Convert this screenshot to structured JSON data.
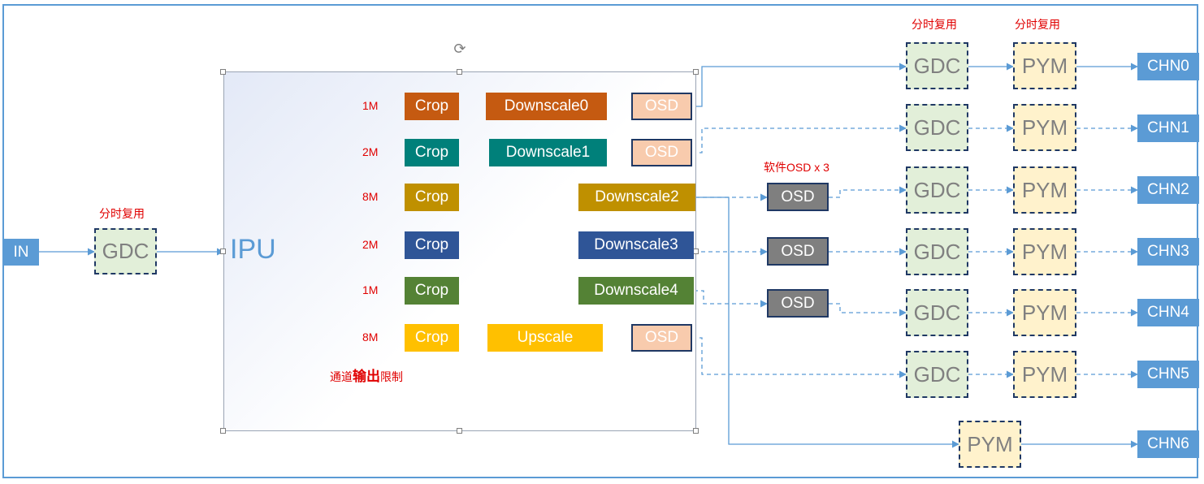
{
  "input": "IN",
  "input_gdc": {
    "label": "GDC",
    "note": "分时复用"
  },
  "ipu": {
    "title": "IPU",
    "limit_note": {
      "prefix": "通道",
      "bold": "输出",
      "suffix": "限制"
    },
    "channels": [
      {
        "size": "1M",
        "crop": "Crop",
        "scale": "Downscale0",
        "osd": "OSD"
      },
      {
        "size": "2M",
        "crop": "Crop",
        "scale": "Downscale1",
        "osd": "OSD"
      },
      {
        "size": "8M",
        "crop": "Crop",
        "scale": "Downscale2"
      },
      {
        "size": "2M",
        "crop": "Crop",
        "scale": "Downscale3"
      },
      {
        "size": "1M",
        "crop": "Crop",
        "scale": "Downscale4"
      },
      {
        "size": "8M",
        "crop": "Crop",
        "scale": "Upscale",
        "osd": "OSD"
      }
    ]
  },
  "software_osd": {
    "note": "软件OSD x 3",
    "labels": [
      "OSD",
      "OSD",
      "OSD"
    ]
  },
  "gdc_note": "分时复用",
  "pym_note": "分时复用",
  "gdc_label": "GDC",
  "pym_label": "PYM",
  "outputs": [
    "CHN0",
    "CHN1",
    "CHN2",
    "CHN3",
    "CHN4",
    "CHN5",
    "CHN6"
  ],
  "colors": {
    "frame": "#5b9bd5",
    "crop": [
      "#c55a11",
      "#00807a",
      "#bf9000",
      "#2f5597",
      "#548235",
      "#ffc000"
    ],
    "scale": [
      "#c55a11",
      "#00807a",
      "#bf9000",
      "#2f5597",
      "#548235",
      "#ffc000"
    ],
    "osd_pink": "#f8cbad",
    "osd_soft": "#7f7f7f",
    "gdc_fill": "#e2efd9",
    "pym_fill": "#fff2cc",
    "chn_fill": "#5b9bd5"
  }
}
